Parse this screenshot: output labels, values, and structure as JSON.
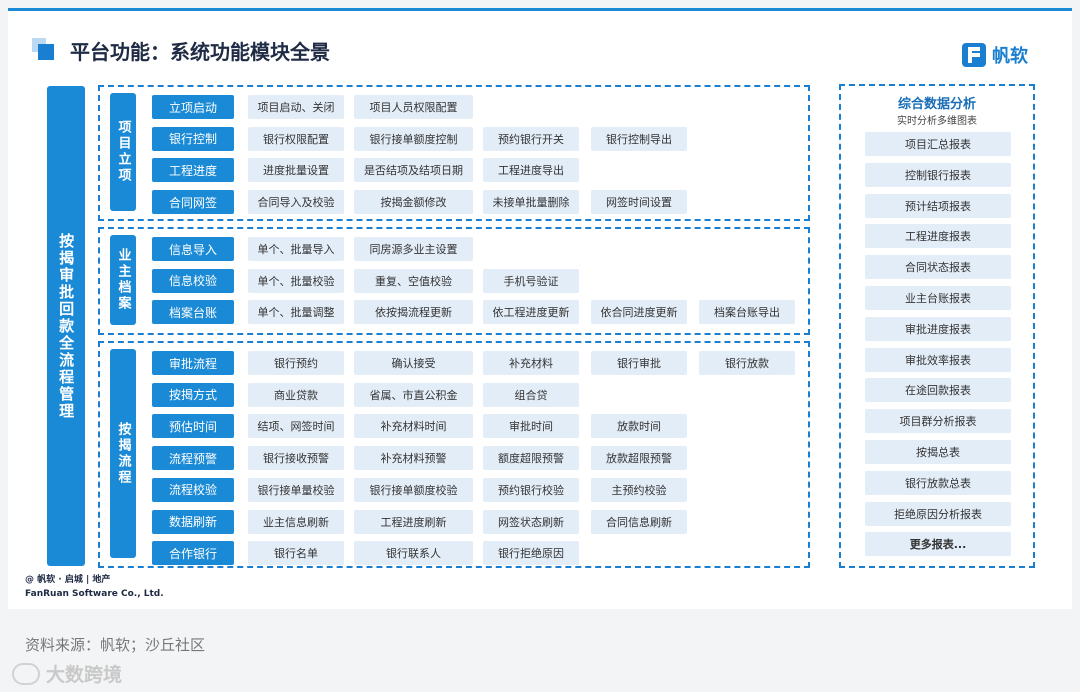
{
  "title": "平台功能：系统功能模块全景",
  "logo": "帆软",
  "main_label": "按揭审批回款全流程管理",
  "groups": [
    {
      "label": "项目立项",
      "rows": [
        {
          "head": "立项启动",
          "cells": [
            "项目启动、关闭",
            "项目人员权限配置"
          ]
        },
        {
          "head": "银行控制",
          "cells": [
            "银行权限配置",
            "银行接单额度控制",
            "预约银行开关",
            "银行控制导出"
          ]
        },
        {
          "head": "工程进度",
          "cells": [
            "进度批量设置",
            "是否结项及结项日期",
            "工程进度导出"
          ]
        },
        {
          "head": "合同网签",
          "cells": [
            "合同导入及校验",
            "按揭金额修改",
            "未接单批量删除",
            "网签时间设置"
          ]
        }
      ]
    },
    {
      "label": "业主档案",
      "rows": [
        {
          "head": "信息导入",
          "cells": [
            "单个、批量导入",
            "同房源多业主设置"
          ]
        },
        {
          "head": "信息校验",
          "cells": [
            "单个、批量校验",
            "重复、空值校验",
            "手机号验证"
          ]
        },
        {
          "head": "档案台账",
          "cells": [
            "单个、批量调整",
            "依按揭流程更新",
            "依工程进度更新",
            "依合同进度更新",
            "档案台账导出"
          ]
        }
      ]
    },
    {
      "label": "按揭流程",
      "rows": [
        {
          "head": "审批流程",
          "cells": [
            "银行预约",
            "确认接受",
            "补充材料",
            "银行审批",
            "银行放款"
          ]
        },
        {
          "head": "按揭方式",
          "cells": [
            "商业贷款",
            "省属、市直公积金",
            "组合贷"
          ]
        },
        {
          "head": "预估时间",
          "cells": [
            "结项、网签时间",
            "补充材料时间",
            "审批时间",
            "放款时间"
          ]
        },
        {
          "head": "流程预警",
          "cells": [
            "银行接收预警",
            "补充材料预警",
            "额度超限预警",
            "放款超限预警"
          ]
        },
        {
          "head": "流程校验",
          "cells": [
            "银行接单量校验",
            "银行接单额度校验",
            "预约银行校验",
            "主预约校验"
          ]
        },
        {
          "head": "数据刷新",
          "cells": [
            "业主信息刷新",
            "工程进度刷新",
            "网签状态刷新",
            "合同信息刷新"
          ]
        },
        {
          "head": "合作银行",
          "cells": [
            "银行名单",
            "银行联系人",
            "银行拒绝原因"
          ]
        }
      ]
    }
  ],
  "right_panel": {
    "title": "综合数据分析",
    "subtitle": "实时分析多维图表",
    "items": [
      "项目汇总报表",
      "控制银行报表",
      "预计结项报表",
      "工程进度报表",
      "合同状态报表",
      "业主台账报表",
      "审批进度报表",
      "审批效率报表",
      "在途回款报表",
      "项目群分析报表",
      "按揭总表",
      "银行放款总表",
      "拒绝原因分析报表",
      "更多报表..."
    ]
  },
  "footer": {
    "brand_line1": "@ 帆软 · 启城 | 地产",
    "brand_line2": "FanRuan Software Co., Ltd."
  },
  "source": "资料来源：帆软；沙丘社区",
  "watermark": "大数跨境"
}
